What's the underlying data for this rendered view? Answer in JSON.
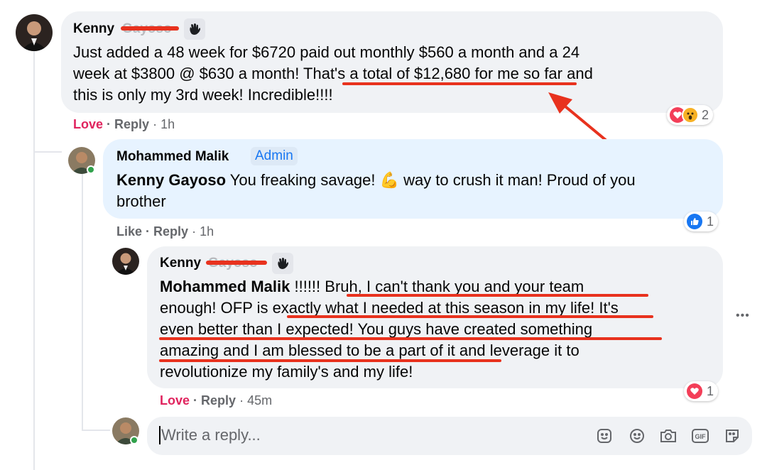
{
  "comment1": {
    "author_visible": "Kenny",
    "author_redacted": "Gayoso",
    "text_lines": [
      "Just added a 48 week for $6720 paid out monthly $560 a month and a 24",
      "week at $3800 @ $630 a month! That's a total of $12,680 for me so far and",
      "this is only my 3rd week! Incredible!!!!"
    ],
    "highlight": "That's a total of $12,680 for me",
    "actions": {
      "love": "Love",
      "reply": "Reply",
      "time": "1h"
    },
    "reaction_count": "2"
  },
  "comment2": {
    "author": "Mohammed Malik",
    "badge": "Admin",
    "mention": "Kenny Gayoso",
    "text_part1": " You freaking savage! ",
    "emoji": "💪",
    "text_part2": " way to crush it man! Proud of you",
    "text_line2": "brother",
    "actions": {
      "like": "Like",
      "reply": "Reply",
      "time": "1h"
    },
    "reaction_count": "1"
  },
  "comment3": {
    "author_visible": "Kenny",
    "author_redacted": "Gayoso",
    "mention": "Mohammed Malik",
    "line1_rest": " !!!!!! Bruh, I can't thank you and your team",
    "line2": "enough! OFP is exactly what I needed at this season in my life! It's",
    "line3": "even better than I expected! You guys have created something",
    "line4": "amazing and I am blessed to be a part of it and leverage it to",
    "line5": "revolutionize my family's and my life!",
    "actions": {
      "love": "Love",
      "reply": "Reply",
      "time": "45m"
    },
    "reaction_count": "1"
  },
  "reply_box": {
    "placeholder": "Write a reply...",
    "icons": [
      "sticker-icon",
      "emoji-icon",
      "camera-icon",
      "gif-icon",
      "avatar-sticker-icon"
    ]
  },
  "more_options": "•••",
  "colors": {
    "annotation_red": "#e8321e",
    "love_red": "#e0245e",
    "admin_blue": "#1877f2",
    "meta_grey": "#65676b"
  }
}
